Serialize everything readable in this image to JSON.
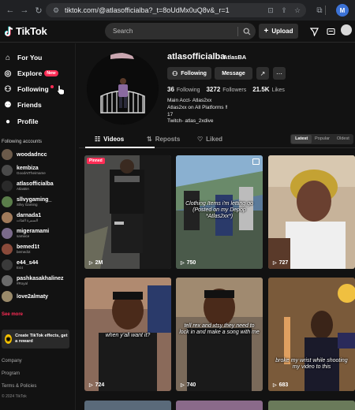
{
  "browser": {
    "url": "tiktok.com/@atlasofficialba?_t=8oUdMx0uQ8v&_r=1",
    "profile_initial": "M",
    "icons": [
      "back-icon",
      "forward-icon",
      "reload-icon",
      "tune-icon",
      "install-icon",
      "share-icon",
      "bookmark-star-icon",
      "extensions-icon"
    ]
  },
  "header": {
    "brand": "TikTok",
    "search_placeholder": "Search",
    "upload_label": "Upload"
  },
  "sidebar": {
    "nav": [
      {
        "label": "For You",
        "icon": "home-icon"
      },
      {
        "label": "Explore",
        "icon": "compass-icon",
        "badge": "New"
      },
      {
        "label": "Following",
        "icon": "following-icon"
      },
      {
        "label": "Friends",
        "icon": "friends-icon"
      },
      {
        "label": "Profile",
        "icon": "profile-icon"
      }
    ],
    "section_title": "Following accounts",
    "accounts": [
      {
        "name": "woodadncc",
        "sub": "",
        "color": "#6b5a4a"
      },
      {
        "name": "kembiza",
        "sub": "GoodAtTheirname",
        "color": "#4a4a4a"
      },
      {
        "name": "atlasofficialba",
        "sub": "AtlasBA",
        "color": "#2a2a2a"
      },
      {
        "name": "sllvygaming_",
        "sub": "Silvy Gaming",
        "color": "#5a7d4a"
      },
      {
        "name": "darnada1",
        "sub": "السمرة الفئات",
        "color": "#a07a5a"
      },
      {
        "name": "migeramami",
        "sub": "samiiice",
        "color": "#7a6a8a"
      },
      {
        "name": "bemed1t",
        "sub": "bemed1t",
        "color": "#8a4a3a"
      },
      {
        "name": "e44_s44",
        "sub": "E44",
        "color": "#3a3a3a"
      },
      {
        "name": "pashkasakhalinez",
        "sub": "#Royal",
        "color": "#6a6a6a"
      },
      {
        "name": "love2almaty",
        "sub": "",
        "color": "#9a8a6a"
      }
    ],
    "see_more": "See more",
    "effects_text": "Create TikTok effects, get a reward",
    "footer": {
      "company": "Company",
      "program": "Program",
      "terms": "Terms & Policies",
      "copyright": "© 2024 TikTok"
    }
  },
  "profile": {
    "username": "atlasofficialba",
    "nickname": "AtlasBA",
    "following_btn": "Following",
    "message_btn": "Message",
    "stats": {
      "following": "36",
      "following_label": "Following",
      "followers": "3272",
      "followers_label": "Followers",
      "likes": "21.5K",
      "likes_label": "Likes"
    },
    "bio": [
      "Main Acct- Atlas2xx",
      "Atlas2xx on All Platforms ‼",
      "17",
      "Twitch- atlas_2xdive"
    ]
  },
  "tabs": {
    "videos": "Videos",
    "reposts": "Reposts",
    "liked": "Liked"
  },
  "sort": {
    "latest": "Latest",
    "popular": "Popular",
    "oldest": "Oldest"
  },
  "videos": [
    {
      "views": "2M",
      "pinned": "Pinned",
      "caption": ""
    },
    {
      "views": "750",
      "caption": "Clothing Items i'm letting go (Posted on my Depop *Atlas2xx*)"
    },
    {
      "views": "727",
      "caption": ""
    },
    {
      "views": "724",
      "caption": "when y'all want it?"
    },
    {
      "views": "740",
      "caption": "tell rex and xtsy they need to lock in and make a song with me"
    },
    {
      "views": "683",
      "caption": "broke my wrist while shooting my video to this"
    }
  ]
}
